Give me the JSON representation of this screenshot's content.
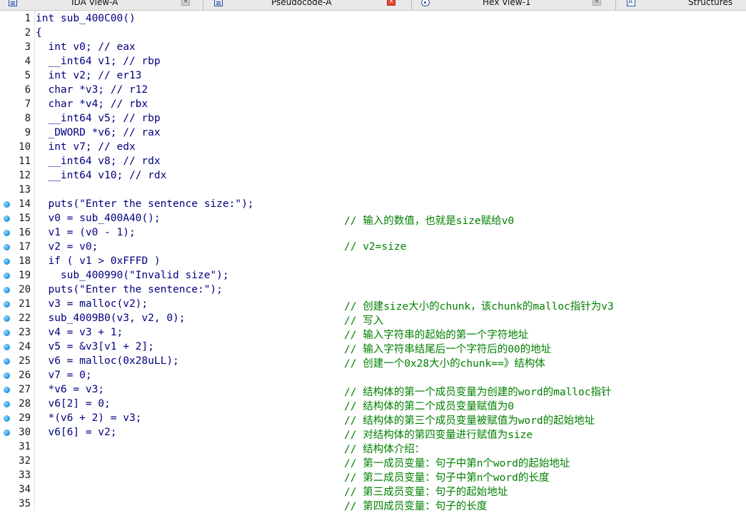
{
  "tabs": [
    {
      "label": "IDA View-A",
      "active": false
    },
    {
      "label": "Pseudocode-A",
      "active": true
    },
    {
      "label": "Hex View-1",
      "active": false
    },
    {
      "label": "Structures",
      "active": false
    }
  ],
  "lines": [
    {
      "num": "1",
      "bp": false,
      "code": "int sub_400C00()",
      "comment": ""
    },
    {
      "num": "2",
      "bp": false,
      "code": "{",
      "comment": ""
    },
    {
      "num": "3",
      "bp": false,
      "code": "  int v0; // eax",
      "comment": ""
    },
    {
      "num": "4",
      "bp": false,
      "code": "  __int64 v1; // rbp",
      "comment": ""
    },
    {
      "num": "5",
      "bp": false,
      "code": "  int v2; // er13",
      "comment": ""
    },
    {
      "num": "6",
      "bp": false,
      "code": "  char *v3; // r12",
      "comment": ""
    },
    {
      "num": "7",
      "bp": false,
      "code": "  char *v4; // rbx",
      "comment": ""
    },
    {
      "num": "8",
      "bp": false,
      "code": "  __int64 v5; // rbp",
      "comment": ""
    },
    {
      "num": "9",
      "bp": false,
      "code": "  _DWORD *v6; // rax",
      "comment": ""
    },
    {
      "num": "10",
      "bp": false,
      "code": "  int v7; // edx",
      "comment": ""
    },
    {
      "num": "11",
      "bp": false,
      "code": "  __int64 v8; // rdx",
      "comment": ""
    },
    {
      "num": "12",
      "bp": false,
      "code": "  __int64 v10; // rdx",
      "comment": ""
    },
    {
      "num": "13",
      "bp": false,
      "code": "",
      "comment": ""
    },
    {
      "num": "14",
      "bp": true,
      "code": "  puts(\"Enter the sentence size:\");",
      "comment": ""
    },
    {
      "num": "15",
      "bp": true,
      "code": "  v0 = sub_400A40();",
      "comment": "// 输入的数值，也就是size赋给v0"
    },
    {
      "num": "16",
      "bp": true,
      "code": "  v1 = (v0 - 1);",
      "comment": ""
    },
    {
      "num": "17",
      "bp": true,
      "code": "  v2 = v0;",
      "comment": "// v2=size"
    },
    {
      "num": "18",
      "bp": true,
      "code": "  if ( v1 > 0xFFFD )",
      "comment": ""
    },
    {
      "num": "19",
      "bp": true,
      "code": "    sub_400990(\"Invalid size\");",
      "comment": ""
    },
    {
      "num": "20",
      "bp": true,
      "code": "  puts(\"Enter the sentence:\");",
      "comment": ""
    },
    {
      "num": "21",
      "bp": true,
      "code": "  v3 = malloc(v2);",
      "comment": "// 创建size大小的chunk，该chunk的malloc指针为v3"
    },
    {
      "num": "22",
      "bp": true,
      "code": "  sub_4009B0(v3, v2, 0);",
      "comment": "// 写入"
    },
    {
      "num": "23",
      "bp": true,
      "code": "  v4 = v3 + 1;",
      "comment": "// 输入字符串的起始的第一个字符地址"
    },
    {
      "num": "24",
      "bp": true,
      "code": "  v5 = &v3[v1 + 2];",
      "comment": "// 输入字符串结尾后一个字符后的00的地址"
    },
    {
      "num": "25",
      "bp": true,
      "code": "  v6 = malloc(0x28uLL);",
      "comment": "// 创建一个0x28大小的chunk==》结构体"
    },
    {
      "num": "26",
      "bp": true,
      "code": "  v7 = 0;",
      "comment": ""
    },
    {
      "num": "27",
      "bp": true,
      "code": "  *v6 = v3;",
      "comment": "// 结构体的第一个成员变量为创建的word的malloc指针"
    },
    {
      "num": "28",
      "bp": true,
      "code": "  v6[2] = 0;",
      "comment": "// 结构体的第二个成员变量赋值为0"
    },
    {
      "num": "29",
      "bp": true,
      "code": "  *(v6 + 2) = v3;",
      "comment": "// 结构体的第三个成员变量被赋值为word的起始地址"
    },
    {
      "num": "30",
      "bp": true,
      "code": "  v6[6] = v2;",
      "comment": "// 对结构体的第四变量进行赋值为size"
    },
    {
      "num": "31",
      "bp": false,
      "code": "",
      "comment": "// 结构体介绍："
    },
    {
      "num": "32",
      "bp": false,
      "code": "",
      "comment": "// 第一成员变量：句子中第n个word的起始地址"
    },
    {
      "num": "33",
      "bp": false,
      "code": "",
      "comment": "// 第二成员变量：句子中第n个word的长度"
    },
    {
      "num": "34",
      "bp": false,
      "code": "",
      "comment": "// 第三成员变量：句子的起始地址"
    },
    {
      "num": "35",
      "bp": false,
      "code": "",
      "comment": "// 第四成员变量：句子的长度"
    }
  ],
  "colors": {
    "code": "#000080",
    "comment": "#008000",
    "line_number": "#1a1a1a",
    "breakpoint_dot": "#1e94dc"
  }
}
